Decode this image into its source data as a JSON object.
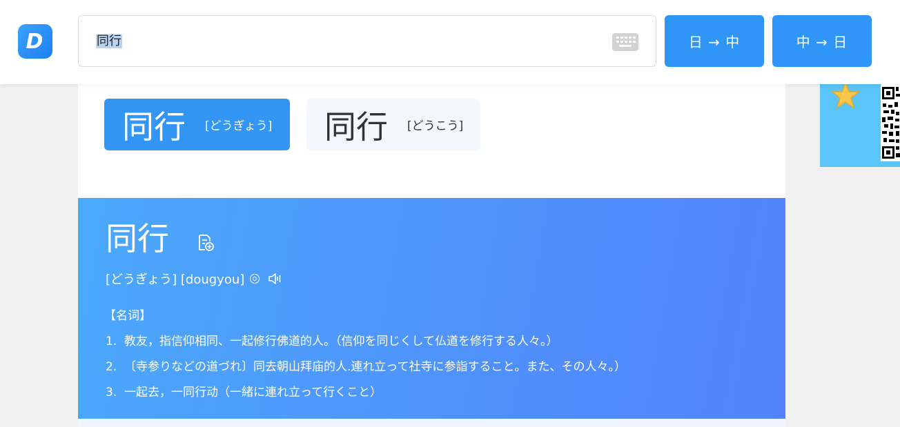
{
  "logo": {
    "letter": "D"
  },
  "search": {
    "value": "同行"
  },
  "buttons": {
    "ja_to_zh": "日 → 中",
    "zh_to_ja": "中 → 日"
  },
  "readings": [
    {
      "word": "同行",
      "kana": "[どうぎょう]",
      "active": true
    },
    {
      "word": "同行",
      "kana": "[どうこう]",
      "active": false
    }
  ],
  "entry": {
    "headword": "同行",
    "pronunciation": "[どうぎょう] [dougyou]",
    "part_of_speech": "【名词】",
    "definitions": [
      {
        "num": "1.",
        "text": "教友，指信仰相同、一起修行佛道的人。（信仰を同じくして仏道を修行する人々。）"
      },
      {
        "num": "2.",
        "text": "〔寺参りなどの道づれ〕同去朝山拜庙的人.連れ立って社寺に参詣すること。また、その人々。）"
      },
      {
        "num": "3.",
        "text": "一起去，一同行动（一緒に連れ立って行くこと）"
      }
    ]
  },
  "colors": {
    "accent": "#2f95f7",
    "panel_gradient_start": "#4ba9fb",
    "panel_gradient_end": "#5283fb",
    "banner": "#5bc4f9"
  }
}
